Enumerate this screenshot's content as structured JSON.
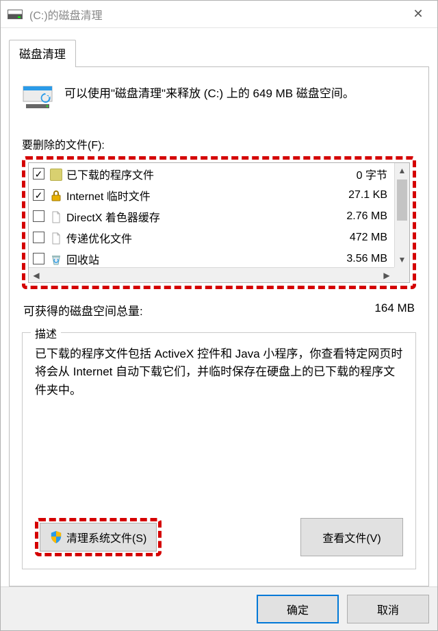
{
  "window": {
    "title": "(C:)的磁盘清理",
    "close_glyph": "✕"
  },
  "tab": {
    "label": "磁盘清理"
  },
  "intro": "可以使用\"磁盘清理\"来释放  (C:) 上的 649 MB 磁盘空间。",
  "files_label": "要删除的文件(F):",
  "files": [
    {
      "checked": true,
      "icon": "folder",
      "name": "已下载的程序文件",
      "size": "0 字节"
    },
    {
      "checked": true,
      "icon": "lock",
      "name": "Internet 临时文件",
      "size": "27.1 KB"
    },
    {
      "checked": false,
      "icon": "page",
      "name": "DirectX 着色器缓存",
      "size": "2.76 MB"
    },
    {
      "checked": false,
      "icon": "page",
      "name": "传递优化文件",
      "size": "472 MB"
    },
    {
      "checked": false,
      "icon": "bin",
      "name": "回收站",
      "size": "3.56 MB"
    }
  ],
  "total": {
    "label": "可获得的磁盘空间总量:",
    "value": "164 MB"
  },
  "description": {
    "legend": "描述",
    "text": "已下载的程序文件包括 ActiveX 控件和 Java 小程序，你查看特定网页时将会从 Internet 自动下载它们，并临时保存在硬盘上的已下载的程序文件夹中。"
  },
  "buttons": {
    "clean_system": "清理系统文件(S)",
    "view_files": "查看文件(V)",
    "ok": "确定",
    "cancel": "取消"
  },
  "scroll": {
    "up": "▲",
    "down": "▼",
    "left": "◀",
    "right": "▶"
  }
}
